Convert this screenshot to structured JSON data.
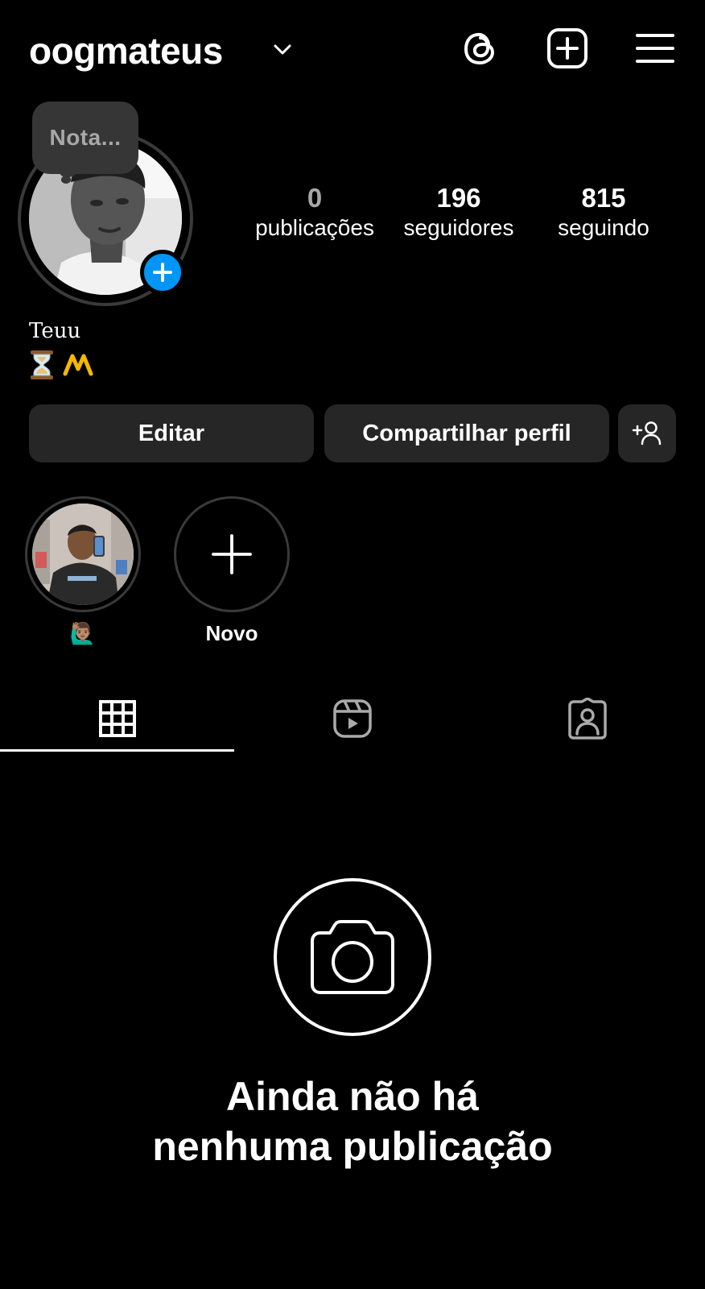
{
  "header": {
    "username": "oogmateus"
  },
  "note": {
    "placeholder": "Nota..."
  },
  "stats": {
    "posts": {
      "value": "0",
      "label": "publicações"
    },
    "followers": {
      "value": "196",
      "label": "seguidores"
    },
    "following": {
      "value": "815",
      "label": "seguindo"
    }
  },
  "bio": {
    "name": "Teuu"
  },
  "buttons": {
    "edit": "Editar",
    "share": "Compartilhar perfil"
  },
  "highlights": [
    {
      "label": "🙋🏽‍♂️"
    },
    {
      "label": "Novo"
    }
  ],
  "empty_state": {
    "line1": "Ainda não há",
    "line2": "nenhuma publicação"
  },
  "colors": {
    "background": "#000000",
    "button": "#262626",
    "accent_blue": "#0095f6",
    "muted_text": "#a8a8a8"
  },
  "icons": {
    "threads": "threads-icon",
    "create": "add-post-icon",
    "menu": "hamburger-menu-icon",
    "grid_tab": "grid-icon",
    "reels_tab": "reels-icon",
    "tagged_tab": "tagged-person-icon",
    "empty": "camera-icon"
  }
}
